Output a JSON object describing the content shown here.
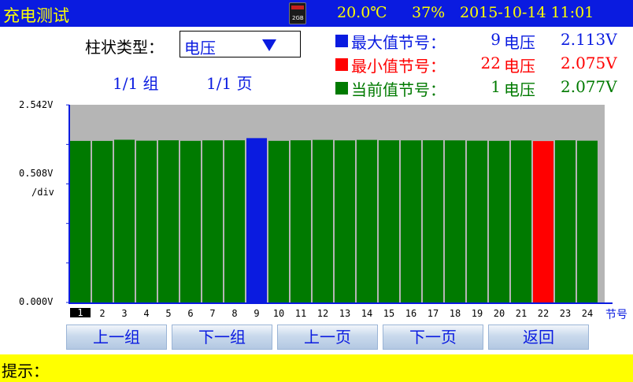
{
  "header": {
    "title": "充电测试",
    "sd_card_icon": "sd-card-icon",
    "sd_card_text": "2GB",
    "temperature": "20.0℃",
    "humidity": "37%",
    "datetime": "2015-10-14  11:01"
  },
  "controls": {
    "type_label": "柱状类型：",
    "type_value": "电压",
    "group_indicator": "1/1  组",
    "page_indicator": "1/1  页"
  },
  "info": {
    "max": {
      "label": "最大值节号：",
      "node": "9",
      "value_label": "电压",
      "value": "2.113V",
      "color": "#0a1be0"
    },
    "min": {
      "label": "最小值节号：",
      "node": "22",
      "value_label": "电压",
      "value": "2.075V",
      "color": "#ff0000"
    },
    "current": {
      "label": "当前值节号：",
      "node": "1",
      "value_label": "电压",
      "value": "2.077V",
      "color": "#007a00"
    }
  },
  "chart_data": {
    "type": "bar",
    "y_tick_labels": [
      "2.542V",
      "0.508V",
      "/div",
      "0.000V"
    ],
    "ylim": [
      0,
      2.542
    ],
    "y_div": 0.508,
    "x_unit_label": "节号",
    "categories": [
      "1",
      "2",
      "3",
      "4",
      "5",
      "6",
      "7",
      "8",
      "9",
      "10",
      "11",
      "12",
      "13",
      "14",
      "15",
      "16",
      "17",
      "18",
      "19",
      "20",
      "21",
      "22",
      "23",
      "24"
    ],
    "values": [
      2.077,
      2.077,
      2.092,
      2.08,
      2.085,
      2.078,
      2.084,
      2.085,
      2.113,
      2.078,
      2.085,
      2.09,
      2.084,
      2.09,
      2.085,
      2.084,
      2.085,
      2.084,
      2.08,
      2.078,
      2.083,
      2.075,
      2.085,
      2.08
    ],
    "highlight_max_index": 8,
    "highlight_min_index": 21,
    "selected_index": 0,
    "colors": {
      "bar": "#007a00",
      "max": "#0a1be0",
      "min": "#ff0000",
      "background": "#b5b5b5",
      "axis": "#0a1be0"
    }
  },
  "buttons": {
    "prev_group": "上一组",
    "next_group": "下一组",
    "prev_page": "上一页",
    "next_page": "下一页",
    "back": "返回"
  },
  "prompt": {
    "label": "提示："
  }
}
